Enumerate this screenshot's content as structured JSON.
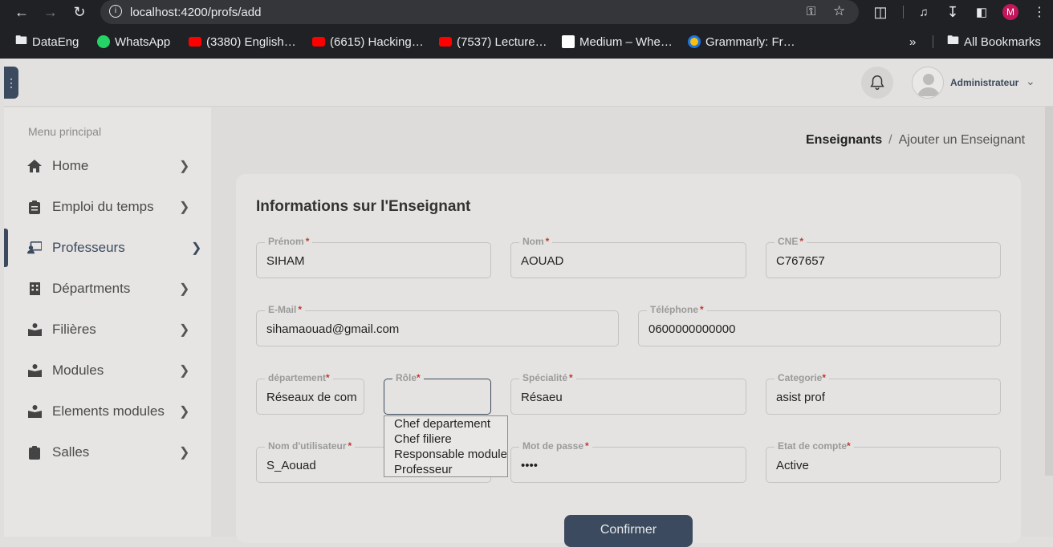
{
  "browser": {
    "url": "localhost:4200/profs/add",
    "profile_initial": "M",
    "bookmarks": [
      {
        "label": "DataEng",
        "icon": "folder-icon"
      },
      {
        "label": "WhatsApp",
        "icon": "whatsapp-icon"
      },
      {
        "label": "(3380) English…",
        "icon": "youtube-icon"
      },
      {
        "label": "(6615) Hacking…",
        "icon": "youtube-icon"
      },
      {
        "label": "(7537) Lecture…",
        "icon": "youtube-icon"
      },
      {
        "label": "Medium – Whe…",
        "icon": "medium-icon"
      },
      {
        "label": "Grammarly: Fr…",
        "icon": "grammarly-icon"
      }
    ],
    "more_label": "»",
    "all_bookmarks": "All Bookmarks"
  },
  "header": {
    "user_name": "Administrateur"
  },
  "sidebar": {
    "title": "Menu principal",
    "items": [
      {
        "label": "Home",
        "icon": "home-icon",
        "active": false
      },
      {
        "label": "Emploi du temps",
        "icon": "clipboard-icon",
        "active": false
      },
      {
        "label": "Professeurs",
        "icon": "teacher-icon",
        "active": true
      },
      {
        "label": "Départments",
        "icon": "building-icon",
        "active": false
      },
      {
        "label": "Filières",
        "icon": "book-reader-icon",
        "active": false
      },
      {
        "label": "Modules",
        "icon": "book-reader-icon",
        "active": false
      },
      {
        "label": "Elements modules",
        "icon": "book-reader-icon",
        "active": false
      },
      {
        "label": "Salles",
        "icon": "clipboard-icon",
        "active": false
      }
    ]
  },
  "breadcrumb": {
    "parent": "Enseignants",
    "separator": "/",
    "current": "Ajouter un Enseignant"
  },
  "form": {
    "title": "Informations sur l'Enseignant",
    "fields": {
      "prenom": {
        "label": "Prénom",
        "value": "SIHAM"
      },
      "nom": {
        "label": "Nom",
        "value": "AOUAD"
      },
      "cne": {
        "label": "CNE",
        "value": "C767657"
      },
      "email": {
        "label": "E-Mail",
        "value": "sihamaouad@gmail.com"
      },
      "telephone": {
        "label": "Téléphone",
        "value": "0600000000000"
      },
      "departement": {
        "label": "département",
        "value": "Réseaux de com"
      },
      "role": {
        "label": "Rôle",
        "value": ""
      },
      "specialite": {
        "label": "Spécialité",
        "value": "Résaeu"
      },
      "categorie": {
        "label": "Categorie",
        "value": "asist prof"
      },
      "username": {
        "label": "Nom d'utilisateur",
        "value": "S_Aouad"
      },
      "password": {
        "label": "Mot de passe",
        "value": "••••"
      },
      "etat": {
        "label": "Etat de compte",
        "value": "Active"
      }
    },
    "required_mark": "*",
    "role_options": [
      "Chef departement",
      "Chef filiere",
      "Responsable module",
      "Professeur"
    ],
    "confirm_label": "Confirmer"
  }
}
